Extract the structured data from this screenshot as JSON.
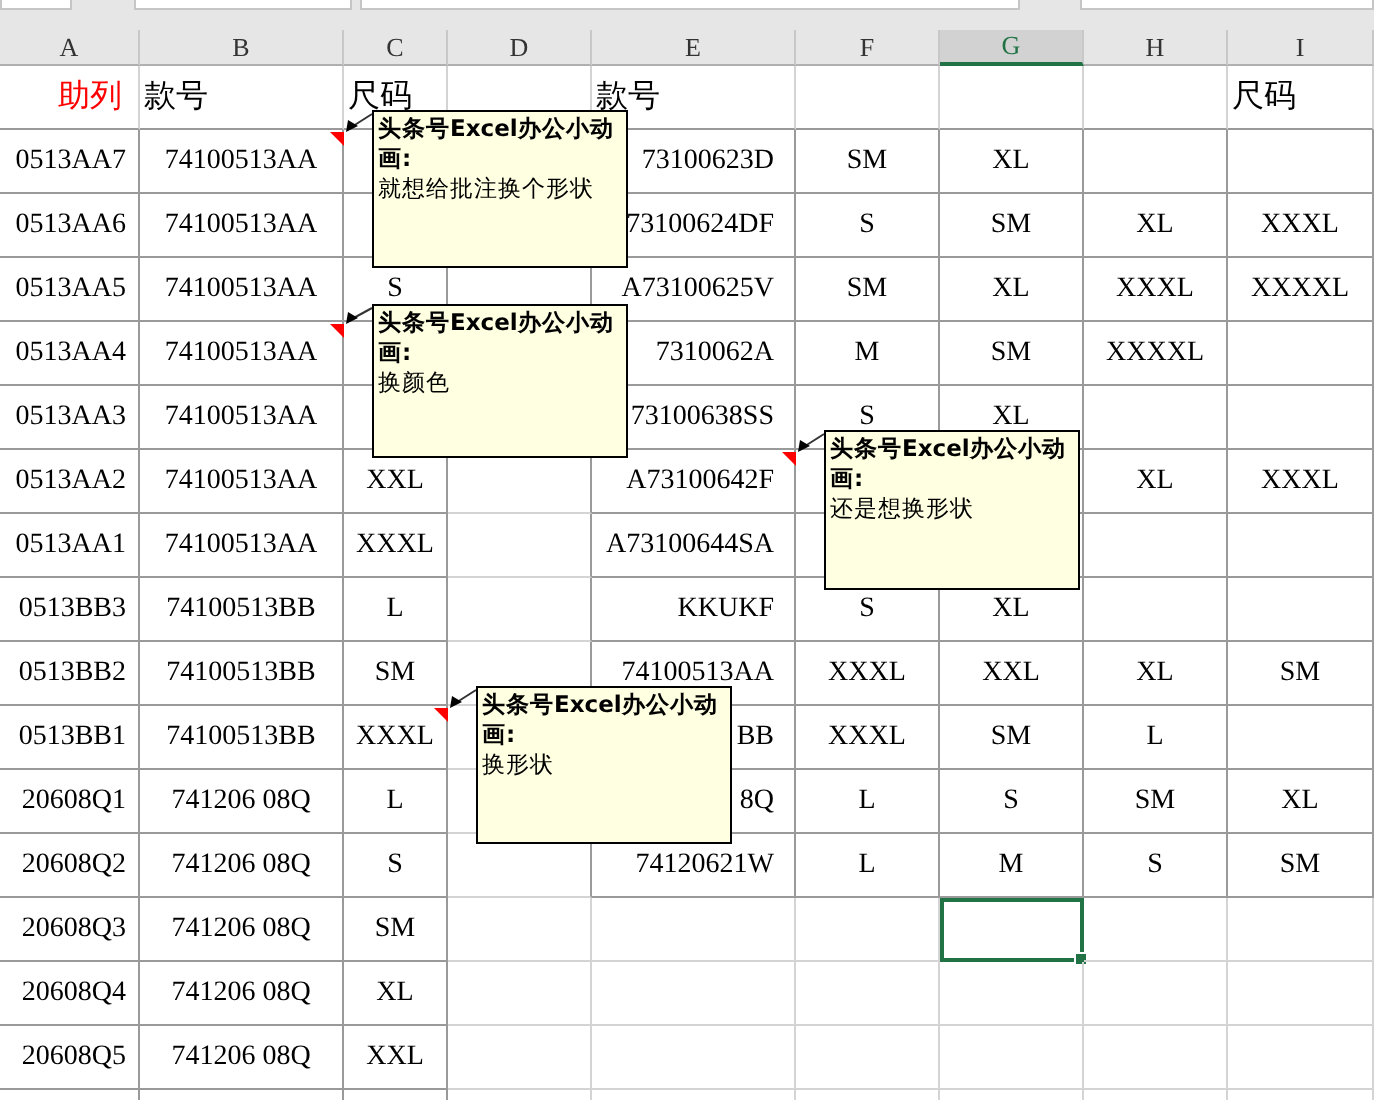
{
  "columns": [
    {
      "label": "A",
      "selected": false
    },
    {
      "label": "B",
      "selected": false
    },
    {
      "label": "C",
      "selected": false
    },
    {
      "label": "D",
      "selected": false
    },
    {
      "label": "E",
      "selected": false
    },
    {
      "label": "F",
      "selected": false
    },
    {
      "label": "G",
      "selected": true
    },
    {
      "label": "H",
      "selected": false
    },
    {
      "label": "I",
      "selected": false
    }
  ],
  "rows": [
    {
      "selected": false,
      "cells": {
        "A": {
          "text": "助列",
          "color": "#ff0000"
        },
        "B": "款号",
        "C": "尺码",
        "E": "款号",
        "I": "尺码"
      }
    },
    {
      "selected": false,
      "cells": {
        "A": "0513AA7",
        "B": "74100513AA",
        "E": "73100623D",
        "F": "SM",
        "G": "XL"
      }
    },
    {
      "selected": false,
      "cells": {
        "A": "0513AA6",
        "B": "74100513AA",
        "E": "73100624DF",
        "F": "S",
        "G": "SM",
        "H": "XL",
        "I": "XXXL"
      }
    },
    {
      "selected": false,
      "cells": {
        "A": "0513AA5",
        "B": "74100513AA",
        "C": "S",
        "E": "A73100625V",
        "F": "SM",
        "G": "XL",
        "H": "XXXL",
        "I": "XXXXL"
      }
    },
    {
      "selected": false,
      "cells": {
        "A": "0513AA4",
        "B": "74100513AA",
        "E": "7310062A",
        "F": "M",
        "G": "SM",
        "H": "XXXXL"
      }
    },
    {
      "selected": false,
      "cells": {
        "A": "0513AA3",
        "B": "74100513AA",
        "E": "73100638SS",
        "F": "S",
        "G": "XL"
      }
    },
    {
      "selected": false,
      "cells": {
        "A": "0513AA2",
        "B": "74100513AA",
        "C": "XXL",
        "E": "A73100642F",
        "H": "XL",
        "I": "XXXL"
      }
    },
    {
      "selected": false,
      "cells": {
        "A": "0513AA1",
        "B": "74100513AA",
        "C": "XXXL",
        "E": "A73100644SA"
      }
    },
    {
      "selected": false,
      "cells": {
        "A": "0513BB3",
        "B": "74100513BB",
        "C": "L",
        "E": "KKUKF",
        "F": "S",
        "G": "XL"
      }
    },
    {
      "selected": false,
      "cells": {
        "A": "0513BB2",
        "B": "74100513BB",
        "C": "SM",
        "E": "74100513AA",
        "F": "XXXL",
        "G": "XXL",
        "H": "XL",
        "I": "SM"
      }
    },
    {
      "selected": false,
      "cells": {
        "A": "0513BB1",
        "B": "74100513BB",
        "C": "XXXL",
        "E": "BB",
        "F": "XXXL",
        "G": "SM",
        "H": "L"
      }
    },
    {
      "selected": false,
      "cells": {
        "A": "20608Q1",
        "B": "741206 08Q",
        "C": "L",
        "E": "8Q",
        "F": "L",
        "G": "S",
        "H": "SM",
        "I": "XL"
      }
    },
    {
      "selected": false,
      "cells": {
        "A": "20608Q2",
        "B": "741206 08Q",
        "C": "S",
        "E": "74120621W",
        "F": "L",
        "G": "M",
        "H": "S",
        "I": "SM"
      }
    },
    {
      "selected": true,
      "cells": {
        "A": "20608Q3",
        "B": "741206 08Q",
        "C": "SM"
      }
    },
    {
      "selected": false,
      "cells": {
        "A": "20608Q4",
        "B": "741206 08Q",
        "C": "XL"
      }
    },
    {
      "selected": false,
      "cells": {
        "A": "20608Q5",
        "B": "741206 08Q",
        "C": "XXL"
      }
    }
  ],
  "comments": [
    {
      "author": "头条号Excel办公小动画:",
      "text": "就想给批注换个形状"
    },
    {
      "author": "头条号Excel办公小动画:",
      "text": "换颜色"
    },
    {
      "author": "头条号Excel办公小动画:",
      "text": "还是想换形状"
    },
    {
      "author": "头条号Excel办公小动画:",
      "text": "换形状"
    }
  ]
}
